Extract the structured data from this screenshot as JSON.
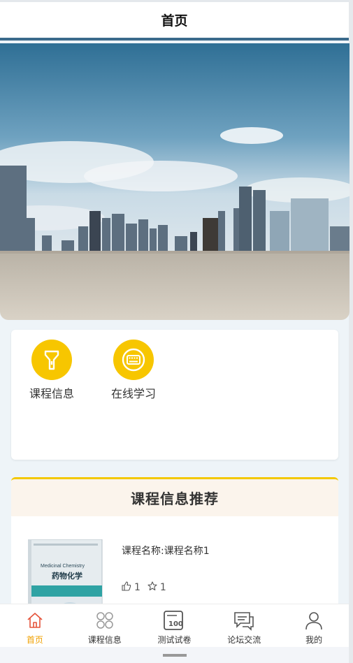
{
  "navbar": {
    "title": "首页"
  },
  "menu": {
    "items": [
      {
        "label": "课程信息",
        "icon": "flashlight-icon"
      },
      {
        "label": "在线学习",
        "icon": "keyboard-icon"
      }
    ]
  },
  "recommend": {
    "title": "课程信息推荐",
    "course": {
      "name": "课程名称:课程名称1",
      "likes": "1",
      "stars": "1",
      "book_title_en": "Medicinal Chemistry",
      "book_title_cn": "药物化学"
    }
  },
  "tabbar": {
    "items": [
      {
        "label": "首页",
        "icon": "home-icon",
        "active": true
      },
      {
        "label": "课程信息",
        "icon": "grid-icon"
      },
      {
        "label": "测试试卷",
        "icon": "exam-paper-icon"
      },
      {
        "label": "论坛交流",
        "icon": "chat-icon"
      },
      {
        "label": "我的",
        "icon": "user-icon"
      }
    ]
  },
  "colors": {
    "accent": "#f7c600",
    "active_tab": "#f0a000",
    "nav_line": "#3b6a8c"
  }
}
